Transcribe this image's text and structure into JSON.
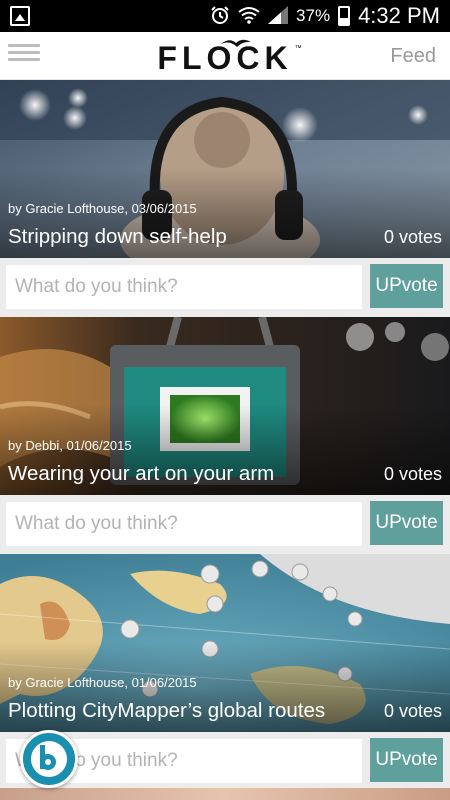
{
  "status_bar": {
    "battery": "37%",
    "battery_level": 0.37,
    "time": "4:32 PM",
    "icons": [
      "gallery-icon",
      "alarm-icon",
      "wifi-icon",
      "signal-icon",
      "battery-icon"
    ]
  },
  "header": {
    "logo": "FLOCK",
    "logo_tm": "™",
    "feed_label": "Feed",
    "menu_icon": "hamburger-menu-icon"
  },
  "colors": {
    "accent": "#5f9f9c",
    "bubble": "#1a8fb0"
  },
  "posts": [
    {
      "byline": "by Gracie Lofthouse, 03/06/2015",
      "title": "Stripping down self-help",
      "votes": "0 votes",
      "comment_placeholder": "What do you think?",
      "upvote_label": "UPvote"
    },
    {
      "byline": "by Debbi, 01/06/2015",
      "title": "Wearing your art on your arm",
      "votes": "0 votes",
      "comment_placeholder": "What do you think?",
      "upvote_label": "UPvote"
    },
    {
      "byline": "by Gracie Lofthouse, 01/06/2015",
      "title": "Plotting CityMapper’s global routes",
      "votes": "0 votes",
      "comment_placeholder": "What do you think?",
      "upvote_label": "UPvote"
    }
  ],
  "floating_button": {
    "icon": "bubble-b-icon"
  }
}
